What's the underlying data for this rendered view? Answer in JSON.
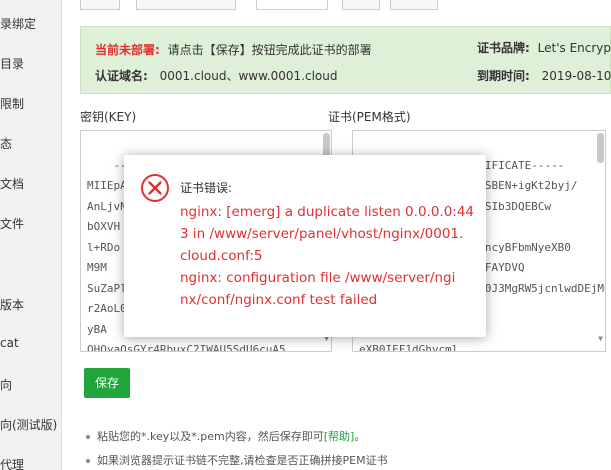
{
  "sidebar": {
    "items": [
      "录绑定",
      "目录",
      "限制",
      "态",
      "文档",
      "文件",
      "版本",
      "cat",
      "向",
      "向(测试版)",
      "代理"
    ]
  },
  "tabs": [
    "",
    "",
    "",
    "",
    ""
  ],
  "info": {
    "status_label": "当前未部署:",
    "status_text": "请点击【保存】按钮完成此证书的部署",
    "brand_label": "证书品牌:",
    "brand_value": "Let's Encrypt",
    "domains_label": "认证域名:",
    "domains_value": "0001.cloud、www.0001.cloud",
    "expire_label": "到期时间:",
    "expire_value": "2019-08-10"
  },
  "key_label": "密钥(KEY)",
  "cert_label": "证书(PEM格式)",
  "key_text": "-----BEGIN RSA PRIVATE KEY-----\nMIIEpA\nAnLjvN\nbOXVH\nl+RDo\nM9M\nSuZaPl\nr2AoL0\nyBA\nQHOyaQsGYr4RbuxC2IWAU5SdU6cuA5",
  "cert_text": "-----BEGIN CERTIFICATE-----\nMIIE7TCCA9WgAwIBAgISBEN+igKt2byj/\nHbCjUcBcNmYpo6ZgSqGSIb3DQEBCw\n\nMSMwIQYDVQQKExpMZXQncyBFbmNyeXB0\nMTIwYjIwMjkAlVTMRYwFAYDVQ\nUzEWMBQGA1UEChMNTGV0J3MgRW5jcnlwdDEjMCEGA1UEAxMaTGV0J3MgRW5jcnlwdCBBdXRob3JpdHkgWDMwHhcNMTkwNTEyMDgyNTE0WhcNMTkwODEwMDgyNTE0WjAVMRMwEQYDVQQDEwowMDAxLmNsb3VkMIIBIjANBgkqhkiG9w0BAQEFAAOCAQ8AMIIBCgKCAQEA\nnNyeXB0MSMwIQ\n\neXB0IEF1dGhvcml\nMTIwMTU1NDda\nFw0x",
  "save_label": "保存",
  "tips": [
    {
      "text": "粘贴您的*.key以及*.pem内容，然后保存即可",
      "link": "[帮助]",
      "after": "。"
    },
    {
      "text": "如果浏览器提示证书链不完整,请检查是否正确拼接PEM证书",
      "link": "",
      "after": ""
    }
  ],
  "dialog": {
    "title": "证书错误:",
    "lines": [
      "nginx: [emerg] a duplicate listen 0.0.0.0:44",
      "3 in /www/server/panel/vhost/nginx/0001.",
      "cloud.conf:5",
      "nginx: configuration file /www/server/ngi",
      "nx/conf/nginx.conf test failed"
    ]
  },
  "colors": {
    "accent_green": "#20a53a",
    "error_red": "#e03030",
    "info_bg": "#dff0d8"
  }
}
